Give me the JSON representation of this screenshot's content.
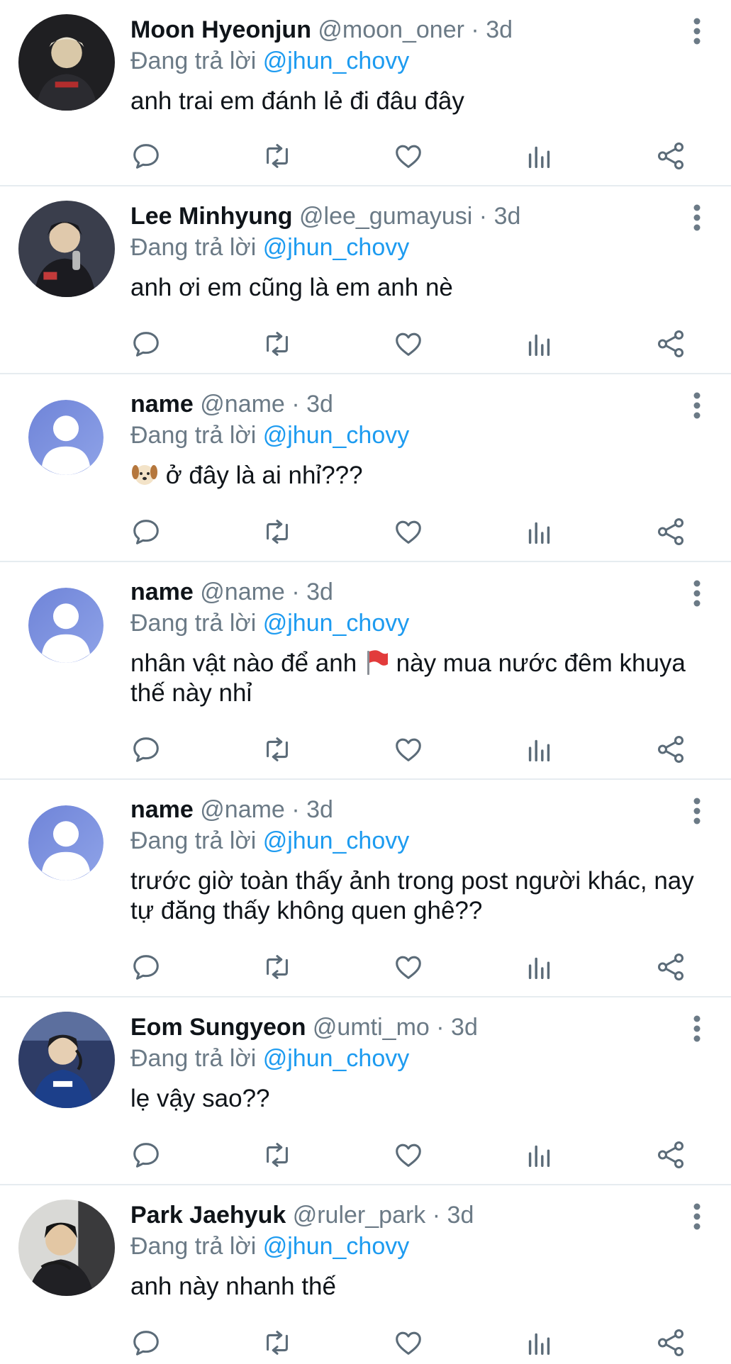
{
  "reply_prefix": "Đang trả lời",
  "reply_to": "@jhun_chovy",
  "icons": {
    "reply": "reply-icon",
    "retweet": "retweet-icon",
    "like": "heart-icon",
    "analytics": "analytics-icon",
    "share": "share-icon",
    "more": "more-vertical-icon"
  },
  "colors": {
    "link": "#1d9bf0",
    "muted": "#6b7a86",
    "divider": "#e6ecf0"
  },
  "tweets": [
    {
      "name": "Moon Hyeonjun",
      "handle": "@moon_oner",
      "time": "3d",
      "text": "anh trai em đánh lẻ đi đâu đây"
    },
    {
      "name": "Lee Minhyung",
      "handle": "@lee_gumayusi",
      "time": "3d",
      "text": "anh ơi em cũng là em anh nè"
    },
    {
      "name": "name",
      "handle": "@name",
      "time": "3d",
      "text_after": "ở đây là ai nhỉ???"
    },
    {
      "name": "name",
      "handle": "@name",
      "time": "3d",
      "text_before": "nhân vật nào để anh",
      "text_after": "này mua nước đêm khuya thế này nhỉ"
    },
    {
      "name": "name",
      "handle": "@name",
      "time": "3d",
      "text": "trước giờ toàn thấy ảnh trong post người khác, nay tự đăng thấy không quen ghê??"
    },
    {
      "name": "Eom Sungyeon",
      "handle": "@umti_mo",
      "time": "3d",
      "text": "lẹ vậy sao??"
    },
    {
      "name": "Park Jaehyuk",
      "handle": "@ruler_park",
      "time": "3d",
      "text": "anh này nhanh thế"
    }
  ]
}
